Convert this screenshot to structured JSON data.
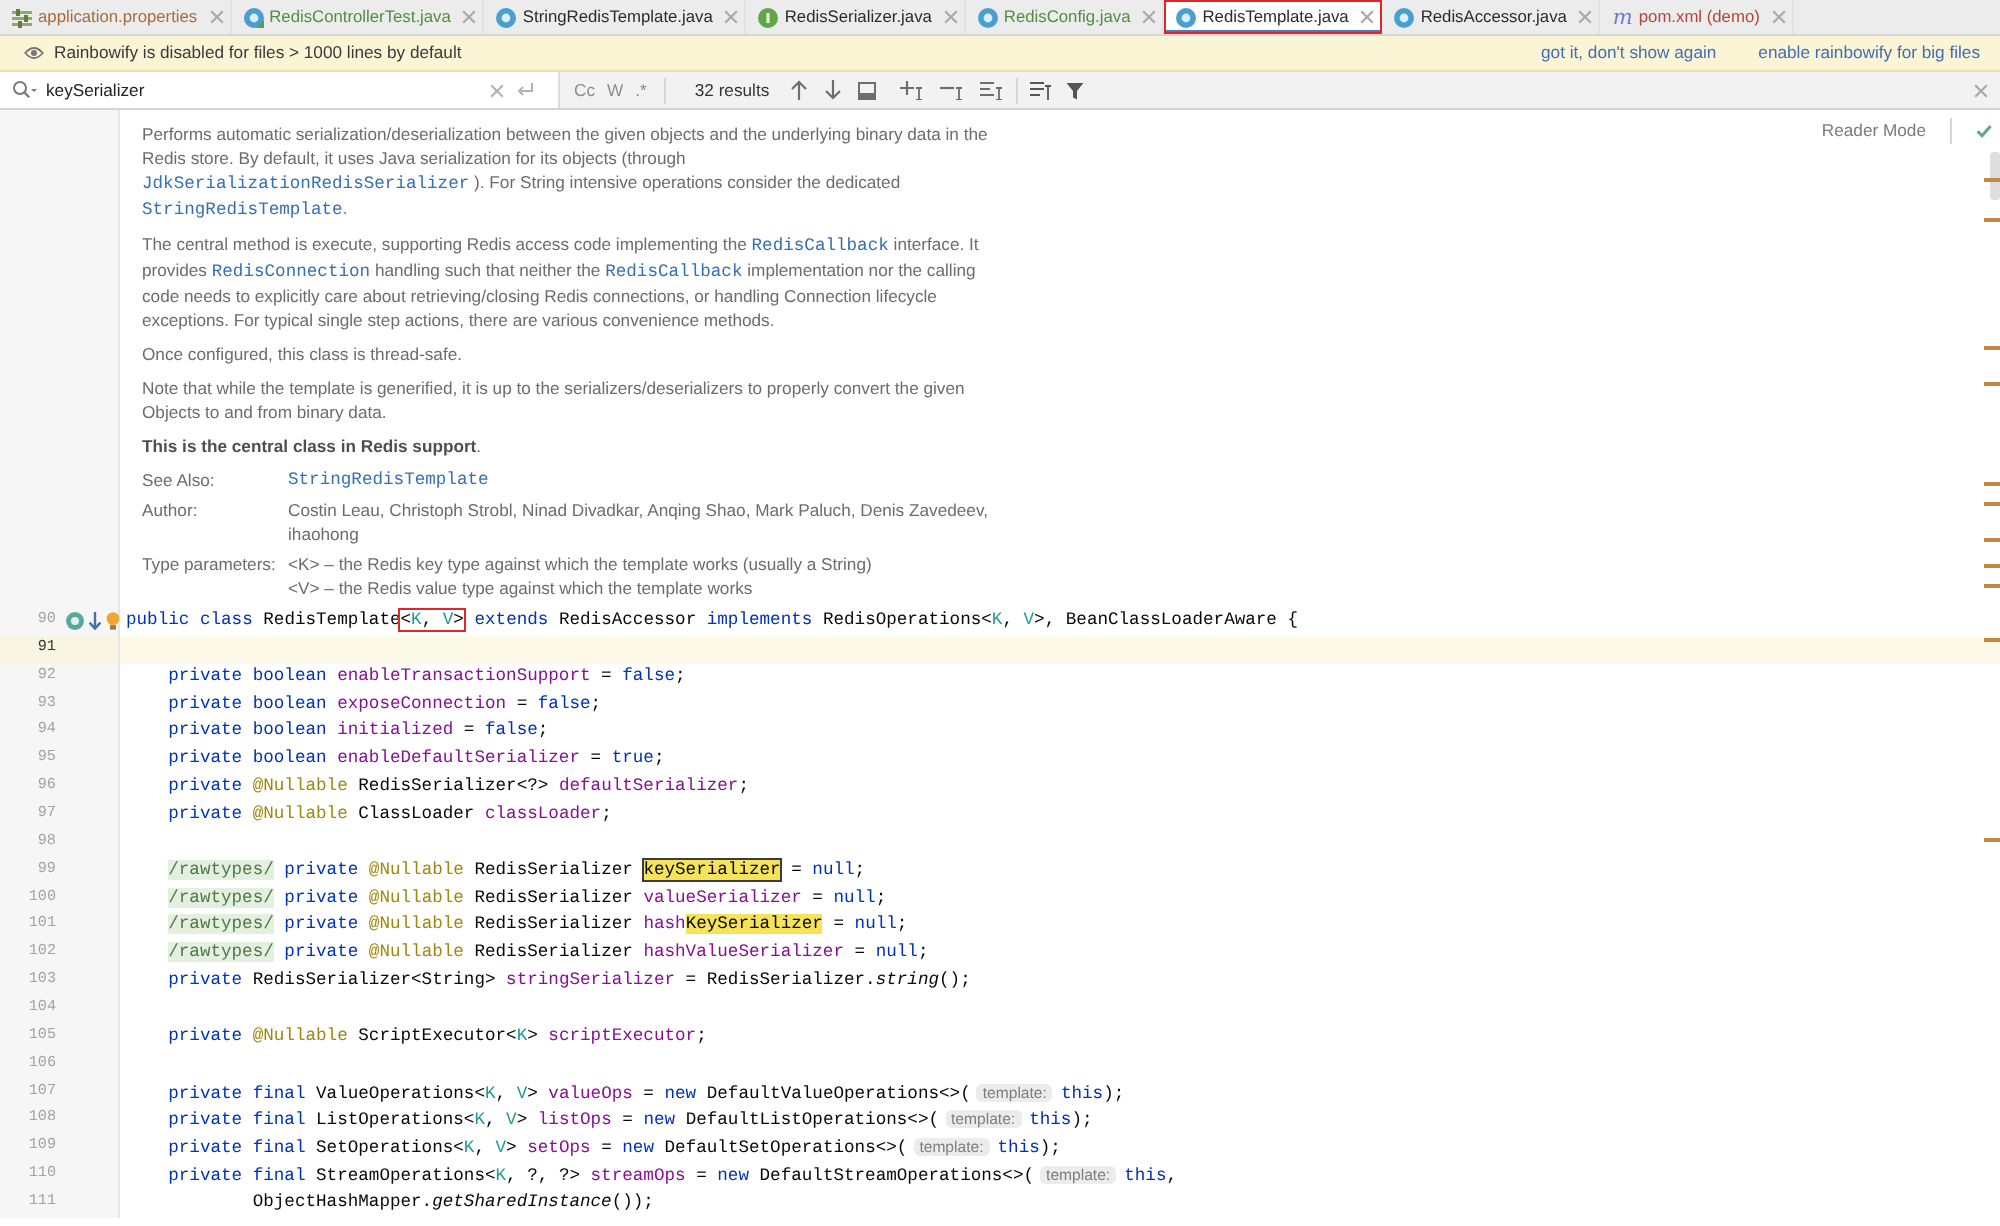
{
  "tabs": [
    {
      "label": "application.properties",
      "kind": "properties",
      "color": "#a86b3a",
      "selected": false
    },
    {
      "label": "RedisControllerTest.java",
      "kind": "test-class",
      "color": "#4f8f3c",
      "selected": false
    },
    {
      "label": "StringRedisTemplate.java",
      "kind": "class",
      "color": "#2b2b2b",
      "selected": false
    },
    {
      "label": "RedisSerializer.java",
      "kind": "interface",
      "color": "#2b2b2b",
      "selected": false
    },
    {
      "label": "RedisConfig.java",
      "kind": "class",
      "color": "#4f8f3c",
      "selected": false
    },
    {
      "label": "RedisTemplate.java",
      "kind": "class",
      "color": "#2b2b2b",
      "selected": true
    },
    {
      "label": "RedisAccessor.java",
      "kind": "class",
      "color": "#2b2b2b",
      "selected": false
    },
    {
      "label": "pom.xml (demo)",
      "kind": "maven",
      "glyph": "m",
      "color": "#b5443a",
      "selected": false
    }
  ],
  "banner": {
    "message": "Rainbowify is disabled for files > 1000 lines by default",
    "actions": [
      "got it, don't show again",
      "enable rainbowify for big files"
    ]
  },
  "search": {
    "query": "keySerializer",
    "options": [
      "Cc",
      "W",
      ".*"
    ],
    "result_count": "32 results"
  },
  "reader_mode": {
    "label": "Reader Mode"
  },
  "doc": {
    "paragraphs": [
      {
        "parts": [
          {
            "kind": "text",
            "text": "Performs automatic serialization/deserialization between the given objects and the underlying binary data in the Redis store. By default, it uses Java serialization for its objects (through "
          },
          {
            "kind": "link",
            "text": "JdkSerializationRedisSerializer"
          },
          {
            "kind": "text",
            "text": " ). For String intensive operations consider the dedicated "
          },
          {
            "kind": "link",
            "text": "StringRedisTemplate"
          },
          {
            "kind": "text",
            "text": "."
          }
        ]
      },
      {
        "parts": [
          {
            "kind": "text",
            "text": "The central method is execute, supporting Redis access code implementing the "
          },
          {
            "kind": "link",
            "text": "RedisCallback"
          },
          {
            "kind": "text",
            "text": " interface. It provides "
          },
          {
            "kind": "link",
            "text": "RedisConnection"
          },
          {
            "kind": "text",
            "text": " handling such that neither the "
          },
          {
            "kind": "link",
            "text": "RedisCallback"
          },
          {
            "kind": "text",
            "text": " implementation nor the calling code needs to explicitly care about retrieving/closing Redis connections, or handling Connection lifecycle exceptions. For typical single step actions, there are various convenience methods."
          }
        ]
      },
      {
        "parts": [
          {
            "kind": "text",
            "text": "Once configured, this class is thread-safe."
          }
        ]
      },
      {
        "parts": [
          {
            "kind": "text",
            "text": "Note that while the template is generified, it is up to the serializers/deserializers to properly convert the given Objects to and from binary data."
          }
        ]
      },
      {
        "parts": [
          {
            "kind": "text",
            "text": "**This is the central class in Redis support**."
          }
        ]
      }
    ],
    "tags": [
      {
        "label": "See Also:",
        "values": [
          {
            "kind": "link",
            "text": "StringRedisTemplate"
          }
        ]
      },
      {
        "label": "Author:",
        "values": [
          {
            "kind": "text",
            "text": "Costin Leau, Christoph Strobl, Ninad Divadkar, Anqing Shao, Mark Paluch, Denis Zavedeev, ihaohong"
          }
        ]
      },
      {
        "label": "Type parameters:",
        "values": [
          {
            "kind": "text",
            "text": "<K> – the Redis key type against which the template works (usually a String)"
          },
          {
            "kind": "text",
            "text": "<V> – the Redis value type against which the template works"
          }
        ]
      }
    ]
  },
  "code": {
    "lines": [
      {
        "number": "90",
        "kind": "declaration",
        "current": false,
        "tokens": [
          {
            "kind": "keyword",
            "text": "public class"
          },
          {
            "kind": "plain",
            "text": " RedisTemplate"
          },
          {
            "kind": "boxed",
            "tokens": [
              {
                "kind": "plain",
                "text": "<"
              },
              {
                "kind": "type_param",
                "text": "K"
              },
              {
                "kind": "plain",
                "text": ", "
              },
              {
                "kind": "type_param",
                "text": "V"
              },
              {
                "kind": "plain",
                "text": ">"
              }
            ]
          },
          {
            "kind": "keyword",
            "text": " extends"
          },
          {
            "kind": "plain",
            "text": " RedisAccessor "
          },
          {
            "kind": "keyword",
            "text": "implements"
          },
          {
            "kind": "plain",
            "text": " RedisOperations<"
          },
          {
            "kind": "type_param",
            "text": "K"
          },
          {
            "kind": "plain",
            "text": ", "
          },
          {
            "kind": "type_param",
            "text": "V"
          },
          {
            "kind": "plain",
            "text": ">, BeanClassLoaderAware {"
          }
        ],
        "children": [
          {
            "number": "91",
            "current": true
          },
          {
            "number": "92",
            "current": false,
            "tokens": [
              {
                "kind": "keyword",
                "text": "private boolean "
              },
              {
                "kind": "field",
                "text": "enableTransactionSupport"
              },
              {
                "kind": "plain",
                "text": " = "
              },
              {
                "kind": "keyword",
                "text": "false"
              },
              {
                "kind": "plain",
                "text": ";"
              }
            ]
          },
          {
            "number": "93",
            "current": false,
            "tokens": [
              {
                "kind": "keyword",
                "text": "private boolean "
              },
              {
                "kind": "field",
                "text": "exposeConnection"
              },
              {
                "kind": "plain",
                "text": " = "
              },
              {
                "kind": "keyword",
                "text": "false"
              },
              {
                "kind": "plain",
                "text": ";"
              }
            ]
          },
          {
            "number": "94",
            "current": false,
            "tokens": [
              {
                "kind": "keyword",
                "text": "private boolean "
              },
              {
                "kind": "field",
                "text": "initialized"
              },
              {
                "kind": "plain",
                "text": " = "
              },
              {
                "kind": "keyword",
                "text": "false"
              },
              {
                "kind": "plain",
                "text": ";"
              }
            ]
          },
          {
            "number": "95",
            "current": false,
            "tokens": [
              {
                "kind": "keyword",
                "text": "private boolean "
              },
              {
                "kind": "field",
                "text": "enableDefaultSerializer"
              },
              {
                "kind": "plain",
                "text": " = "
              },
              {
                "kind": "keyword",
                "text": "true"
              },
              {
                "kind": "plain",
                "text": ";"
              }
            ]
          },
          {
            "number": "96",
            "current": false,
            "tokens": [
              {
                "kind": "keyword",
                "text": "private "
              },
              {
                "kind": "annotation",
                "text": "@Nullable"
              },
              {
                "kind": "plain",
                "text": " RedisSerializer<?> "
              },
              {
                "kind": "field",
                "text": "defaultSerializer"
              },
              {
                "kind": "plain",
                "text": ";"
              }
            ]
          },
          {
            "number": "97",
            "current": false,
            "tokens": [
              {
                "kind": "keyword",
                "text": "private "
              },
              {
                "kind": "annotation",
                "text": "@Nullable"
              },
              {
                "kind": "plain",
                "text": " ClassLoader "
              },
              {
                "kind": "field",
                "text": "classLoader"
              },
              {
                "kind": "plain",
                "text": ";"
              }
            ]
          },
          {
            "number": "98",
            "current": false
          },
          {
            "number": "99",
            "current": false,
            "tokens": [
              {
                "kind": "folded",
                "text": "/rawtypes/"
              },
              {
                "kind": "keyword",
                "text": " private "
              },
              {
                "kind": "annotation",
                "text": "@Nullable"
              },
              {
                "kind": "plain",
                "text": " RedisSerializer "
              },
              {
                "kind": "current_match",
                "text": "keySerializer"
              },
              {
                "kind": "plain",
                "text": " = "
              },
              {
                "kind": "keyword",
                "text": "null"
              },
              {
                "kind": "plain",
                "text": ";"
              }
            ]
          },
          {
            "number": "100",
            "current": false,
            "tokens": [
              {
                "kind": "folded",
                "text": "/rawtypes/"
              },
              {
                "kind": "keyword",
                "text": " private "
              },
              {
                "kind": "annotation",
                "text": "@Nullable"
              },
              {
                "kind": "plain",
                "text": " RedisSerializer "
              },
              {
                "kind": "field",
                "text": "valueSerializer"
              },
              {
                "kind": "plain",
                "text": " = "
              },
              {
                "kind": "keyword",
                "text": "null"
              },
              {
                "kind": "plain",
                "text": ";"
              }
            ]
          },
          {
            "number": "101",
            "current": false,
            "tokens": [
              {
                "kind": "folded",
                "text": "/rawtypes/"
              },
              {
                "kind": "keyword",
                "text": " private "
              },
              {
                "kind": "annotation",
                "text": "@Nullable"
              },
              {
                "kind": "plain",
                "text": " RedisSerializer "
              },
              {
                "kind": "field",
                "text": "hash"
              },
              {
                "kind": "match",
                "text": "KeySerializer"
              },
              {
                "kind": "plain",
                "text": " = "
              },
              {
                "kind": "keyword",
                "text": "null"
              },
              {
                "kind": "plain",
                "text": ";"
              }
            ]
          },
          {
            "number": "102",
            "current": false,
            "tokens": [
              {
                "kind": "folded",
                "text": "/rawtypes/"
              },
              {
                "kind": "keyword",
                "text": " private "
              },
              {
                "kind": "annotation",
                "text": "@Nullable"
              },
              {
                "kind": "plain",
                "text": " RedisSerializer "
              },
              {
                "kind": "field",
                "text": "hashValueSerializer"
              },
              {
                "kind": "plain",
                "text": " = "
              },
              {
                "kind": "keyword",
                "text": "null"
              },
              {
                "kind": "plain",
                "text": ";"
              }
            ]
          },
          {
            "number": "103",
            "current": false,
            "tokens": [
              {
                "kind": "keyword",
                "text": "private "
              },
              {
                "kind": "plain",
                "text": "RedisSerializer<String> "
              },
              {
                "kind": "field",
                "text": "stringSerializer"
              },
              {
                "kind": "plain",
                "text": " = RedisSerializer."
              },
              {
                "kind": "static",
                "text": "string"
              },
              {
                "kind": "plain",
                "text": "();"
              }
            ]
          },
          {
            "number": "104",
            "current": false
          },
          {
            "number": "105",
            "current": false,
            "tokens": [
              {
                "kind": "keyword",
                "text": "private "
              },
              {
                "kind": "annotation",
                "text": "@Nullable"
              },
              {
                "kind": "plain",
                "text": " ScriptExecutor<"
              },
              {
                "kind": "type_param",
                "text": "K"
              },
              {
                "kind": "plain",
                "text": "> "
              },
              {
                "kind": "field",
                "text": "scriptExecutor"
              },
              {
                "kind": "plain",
                "text": ";"
              }
            ]
          },
          {
            "number": "106",
            "current": false
          },
          {
            "number": "107",
            "current": false,
            "tokens": [
              {
                "kind": "keyword",
                "text": "private final "
              },
              {
                "kind": "plain",
                "text": "ValueOperations<"
              },
              {
                "kind": "type_param",
                "text": "K"
              },
              {
                "kind": "plain",
                "text": ", "
              },
              {
                "kind": "type_param",
                "text": "V"
              },
              {
                "kind": "plain",
                "text": "> "
              },
              {
                "kind": "field",
                "text": "valueOps"
              },
              {
                "kind": "plain",
                "text": " = "
              },
              {
                "kind": "keyword",
                "text": "new "
              },
              {
                "kind": "plain",
                "text": "DefaultValueOperations<>("
              },
              {
                "kind": "hint",
                "text": "template:"
              },
              {
                "kind": "keyword",
                "text": "this"
              },
              {
                "kind": "plain",
                "text": ");"
              }
            ]
          },
          {
            "number": "108",
            "current": false,
            "tokens": [
              {
                "kind": "keyword",
                "text": "private final "
              },
              {
                "kind": "plain",
                "text": "ListOperations<"
              },
              {
                "kind": "type_param",
                "text": "K"
              },
              {
                "kind": "plain",
                "text": ", "
              },
              {
                "kind": "type_param",
                "text": "V"
              },
              {
                "kind": "plain",
                "text": "> "
              },
              {
                "kind": "field",
                "text": "listOps"
              },
              {
                "kind": "plain",
                "text": " = "
              },
              {
                "kind": "keyword",
                "text": "new "
              },
              {
                "kind": "plain",
                "text": "DefaultListOperations<>("
              },
              {
                "kind": "hint",
                "text": "template:"
              },
              {
                "kind": "keyword",
                "text": "this"
              },
              {
                "kind": "plain",
                "text": ");"
              }
            ]
          },
          {
            "number": "109",
            "current": false,
            "tokens": [
              {
                "kind": "keyword",
                "text": "private final "
              },
              {
                "kind": "plain",
                "text": "SetOperations<"
              },
              {
                "kind": "type_param",
                "text": "K"
              },
              {
                "kind": "plain",
                "text": ", "
              },
              {
                "kind": "type_param",
                "text": "V"
              },
              {
                "kind": "plain",
                "text": "> "
              },
              {
                "kind": "field",
                "text": "setOps"
              },
              {
                "kind": "plain",
                "text": " = "
              },
              {
                "kind": "keyword",
                "text": "new "
              },
              {
                "kind": "plain",
                "text": "DefaultSetOperations<>("
              },
              {
                "kind": "hint",
                "text": "template:"
              },
              {
                "kind": "keyword",
                "text": "this"
              },
              {
                "kind": "plain",
                "text": ");"
              }
            ]
          },
          {
            "number": "110",
            "current": false,
            "tokens": [
              {
                "kind": "keyword",
                "text": "private final "
              },
              {
                "kind": "plain",
                "text": "StreamOperations<"
              },
              {
                "kind": "type_param",
                "text": "K"
              },
              {
                "kind": "plain",
                "text": ", ?, ?> "
              },
              {
                "kind": "field",
                "text": "streamOps"
              },
              {
                "kind": "plain",
                "text": " = "
              },
              {
                "kind": "keyword",
                "text": "new "
              },
              {
                "kind": "plain",
                "text": "DefaultStreamOperations<>("
              },
              {
                "kind": "hint",
                "text": "template:"
              },
              {
                "kind": "keyword",
                "text": "this"
              },
              {
                "kind": "plain",
                "text": ","
              }
            ],
            "children": [
              {
                "number": "111",
                "kind": "continuation",
                "current": false,
                "tokens": [
                  {
                    "kind": "plain",
                    "text": "ObjectHashMapper."
                  },
                  {
                    "kind": "static",
                    "text": "getSharedInstance"
                  },
                  {
                    "kind": "plain",
                    "text": "());"
                  }
                ]
              }
            ]
          }
        ]
      }
    ]
  }
}
